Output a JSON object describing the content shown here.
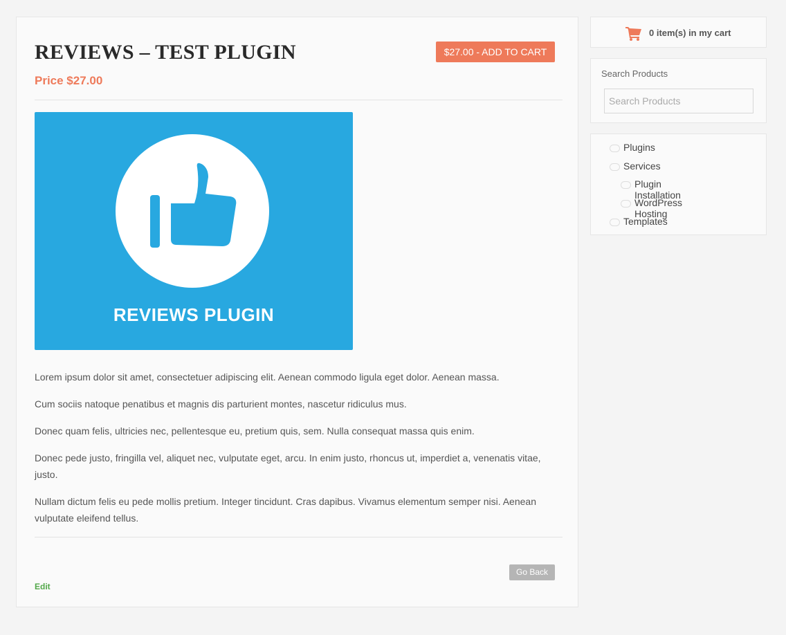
{
  "product": {
    "title": "REVIEWS – TEST PLUGIN",
    "price": "Price $27.00",
    "add_to_cart_label": "$27.00 - ADD TO CART",
    "image_caption": "REVIEWS PLUGIN",
    "image_color": "#28a8e0",
    "description": [
      "Lorem ipsum dolor sit amet, consectetuer adipiscing elit. Aenean commodo ligula eget dolor. Aenean massa.",
      "Cum sociis natoque penatibus et magnis dis parturient montes, nascetur ridiculus mus.",
      "Donec quam felis, ultricies nec, pellentesque eu, pretium quis, sem. Nulla consequat massa quis enim.",
      "Donec pede justo, fringilla vel, aliquet nec, vulputate eget, arcu. In enim justo, rhoncus ut, imperdiet a, venenatis vitae, justo.",
      "Nullam dictum felis eu pede mollis pretium. Integer tincidunt. Cras dapibus. Vivamus elementum semper nisi. Aenean vulputate eleifend tellus."
    ],
    "go_back_label": "Go Back",
    "edit_label": "Edit"
  },
  "sidebar": {
    "cart": {
      "icon": "cart-icon",
      "text": "0 item(s) in my cart"
    },
    "search": {
      "title": "Search Products",
      "placeholder": "Search Products",
      "value": ""
    },
    "categories": [
      {
        "label": "Plugins",
        "level": 0
      },
      {
        "label": "Services",
        "level": 0
      },
      {
        "label": "Plugin Installation",
        "level": 1
      },
      {
        "label": "WordPress Hosting",
        "level": 1
      },
      {
        "label": "Templates",
        "level": 0
      }
    ]
  },
  "colors": {
    "accent": "#ee7a5a",
    "edit_link": "#53a84a",
    "button_secondary": "#b5b5b5"
  }
}
